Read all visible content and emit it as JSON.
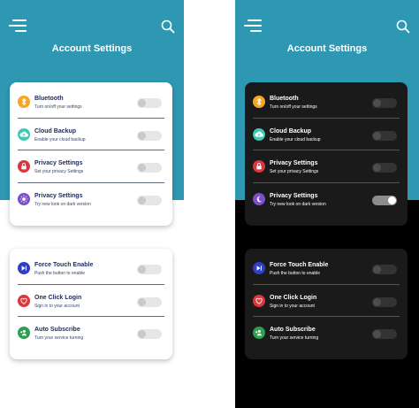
{
  "screens": [
    {
      "theme": "light",
      "title": "Account Settings",
      "group1": [
        {
          "label": "Bluetooth",
          "sub": "Turn on/off your settings",
          "icon": "bluetooth-icon",
          "color": "#f5a623",
          "on": false
        },
        {
          "label": "Cloud Backup",
          "sub": "Enable your cloud backup",
          "icon": "cloud-backup-icon",
          "color": "#3fc9b3",
          "on": false
        },
        {
          "label": "Privacy Settings",
          "sub": "Set your privacy Settings",
          "icon": "lock-icon",
          "color": "#d9363e",
          "on": false
        },
        {
          "label": "Privacy Settings",
          "sub": "Try new look on dark version",
          "icon": "brightness-icon",
          "color": "#7b4fc9",
          "on": false
        }
      ],
      "group2": [
        {
          "label": "Force Touch Enable",
          "sub": "Push the button to enable",
          "icon": "play-next-icon",
          "color": "#2f3fc4",
          "on": false
        },
        {
          "label": "One Click Login",
          "sub": "Sign in to your account",
          "icon": "heart-icon",
          "color": "#d9363e",
          "on": false
        },
        {
          "label": "Auto Subscribe",
          "sub": "Turn your service turning",
          "icon": "add-user-icon",
          "color": "#2e9e4f",
          "on": false
        }
      ]
    },
    {
      "theme": "dark",
      "title": "Account Settings",
      "group1": [
        {
          "label": "Bluetooth",
          "sub": "Turn on/off your settings",
          "icon": "bluetooth-icon",
          "color": "#f5a623",
          "on": false
        },
        {
          "label": "Cloud Backup",
          "sub": "Enable your cloud backup",
          "icon": "cloud-backup-icon",
          "color": "#3fc9b3",
          "on": false
        },
        {
          "label": "Privacy Settings",
          "sub": "Set your privacy Settings",
          "icon": "lock-icon",
          "color": "#d9363e",
          "on": false
        },
        {
          "label": "Privacy Settings",
          "sub": "Try new look on dark version",
          "icon": "moon-icon",
          "color": "#7b4fc9",
          "on": true
        }
      ],
      "group2": [
        {
          "label": "Force Touch Enable",
          "sub": "Push the button to enable",
          "icon": "play-next-icon",
          "color": "#2f3fc4",
          "on": false
        },
        {
          "label": "One Click Login",
          "sub": "Sign in to your account",
          "icon": "heart-icon",
          "color": "#d9363e",
          "on": false
        },
        {
          "label": "Auto Subscribe",
          "sub": "Turn your service turning",
          "icon": "add-user-icon",
          "color": "#2e9e4f",
          "on": false
        }
      ]
    }
  ],
  "colors": {
    "header": "#2e98b3",
    "dark_bg": "#000000",
    "dark_card": "#1a1a1a"
  }
}
